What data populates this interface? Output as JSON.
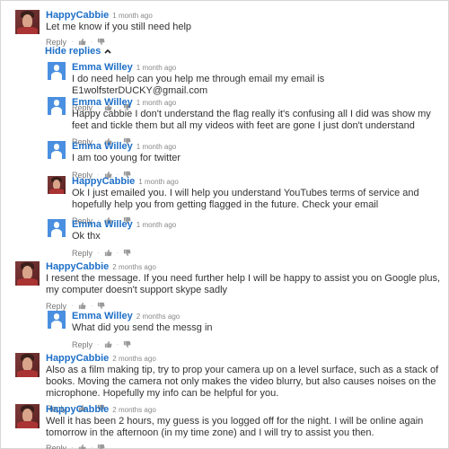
{
  "hide_replies_label": "Hide replies",
  "reply_label": "Reply",
  "separator": "·",
  "comments": [
    {
      "author": "HappyCabbie",
      "time": "1 month ago",
      "text": "Let me know if you still need help"
    },
    {
      "author": "Emma Willey",
      "time": "1 month ago",
      "text": "I do need help can you help me through email my email is E1wolfsterDUCKY@gmail.com"
    },
    {
      "author": "Emma Willey",
      "time": "1 month ago",
      "text": "Happy cabbie I don't understand the flag really it's confusing all I did was show my feet and tickle them but all my videos with feet are gone I just don't understand"
    },
    {
      "author": "Emma Willey",
      "time": "1 month ago",
      "text": "I am too young for twitter"
    },
    {
      "author": "HappyCabbie",
      "time": "1 month ago",
      "text": "Ok I just emailed you. I will help you understand YouTubes terms of service and hopefully help you from getting flagged in the future.  Check your email"
    },
    {
      "author": "Emma Willey",
      "time": "1 month ago",
      "text": "Ok thx"
    },
    {
      "author": "HappyCabbie",
      "time": "2 months ago",
      "text": "I resent the message.  If you need further help I will be happy to assist you on Google plus, my computer doesn't support skype sadly"
    },
    {
      "author": "Emma Willey",
      "time": "2 months ago",
      "text": "What did you send the messg in"
    },
    {
      "author": "HappyCabbie",
      "time": "2 months ago",
      "text": "Also as a film making tip, try to prop your camera up on a level surface, such as a stack of books.  Moving the camera not only makes the video blurry, but also causes noises on the microphone.  Hopefully my info can be helpful for you."
    },
    {
      "author": "HappyCabbie",
      "time": "2 months ago",
      "text": "Well it has been 2 hours, my guess is you logged off for the night. I will be online again tomorrow in the afternoon (in my time zone) and I will try to assist you then."
    }
  ]
}
